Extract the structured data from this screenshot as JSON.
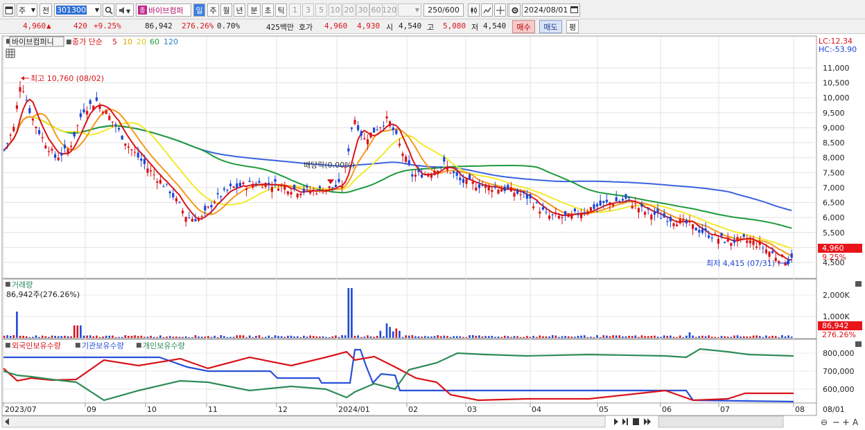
{
  "toolbar": {
    "period_week": "주",
    "prev_label": "전",
    "stock_code": "301300",
    "stock_name": "바이브컴퍼",
    "fav_mark": "종",
    "period_tabs": [
      "일",
      "주",
      "월",
      "년",
      "분",
      "초",
      "틱"
    ],
    "minute_options": [
      "1",
      "3",
      "5",
      "10",
      "20",
      "30",
      "60",
      "120"
    ],
    "view_count": "250",
    "view_total": "/600",
    "date": "2024/08/01"
  },
  "quote": {
    "price": "4,960",
    "change_arrow": "▲",
    "change": "420",
    "change_rate": "+9.25%",
    "volume": "86,942",
    "volume_rate": "276.26%",
    "turnover": "0.70%",
    "amount": "425백만",
    "ask_label": "호가",
    "ask1": "4,960",
    "ask2": "4,930",
    "open_label": "시",
    "open": "4,540",
    "high_label": "고",
    "high": "5,080",
    "low_label": "저",
    "low": "4,540",
    "buy_label": "매수",
    "sell_label": "매도",
    "eval_label": "평"
  },
  "chart": {
    "legend_name": "바이브컴퍼니",
    "legend_ma": "종가 단순",
    "ma_periods": [
      "5",
      "10",
      "20",
      "60",
      "120"
    ],
    "lc_label": "LC:12.34",
    "hc_label": "HC:-53.90",
    "high_marker": "최고 10,760 (08/02)",
    "low_marker": "최저 4,415 (07/31)",
    "dividend_marker": "배당락(0.00%)",
    "price_tag": "4,960",
    "price_change_tag": "9.25%",
    "price_axis": [
      "11,000",
      "10,500",
      "10,000",
      "9,500",
      "9,000",
      "8,500",
      "8,000",
      "7,500",
      "7,000",
      "6,500",
      "6,000",
      "5,500",
      "5,000",
      "4,500"
    ],
    "volume_title": "거래량",
    "volume_value": "86,942주(276.26%)",
    "volume_axis": [
      "2,000K",
      "1,000K"
    ],
    "volume_tag": "86,942",
    "volume_rate_tag": "276.26%",
    "holding_legend": [
      "외국인보유수량",
      "기관보유수량",
      "개인보유수량"
    ],
    "holding_axis": [
      "800,000",
      "700,000",
      "600,000"
    ],
    "date_axis": [
      "2023/07",
      "09",
      "10",
      "11",
      "12",
      "2024/01",
      "02",
      "03",
      "04",
      "05",
      "06",
      "07",
      "08",
      "08/01"
    ]
  },
  "colors": {
    "candle_up": "#d8141a",
    "candle_down": "#1d45d8",
    "ma5": "#d8141a",
    "ma10": "#f39a1a",
    "ma20": "#f2ea2a",
    "ma60": "#1e9a3a",
    "ma120": "#3a62e0",
    "foreign": "#d8141a",
    "institution": "#2850d8",
    "individual": "#2e8b57"
  }
}
